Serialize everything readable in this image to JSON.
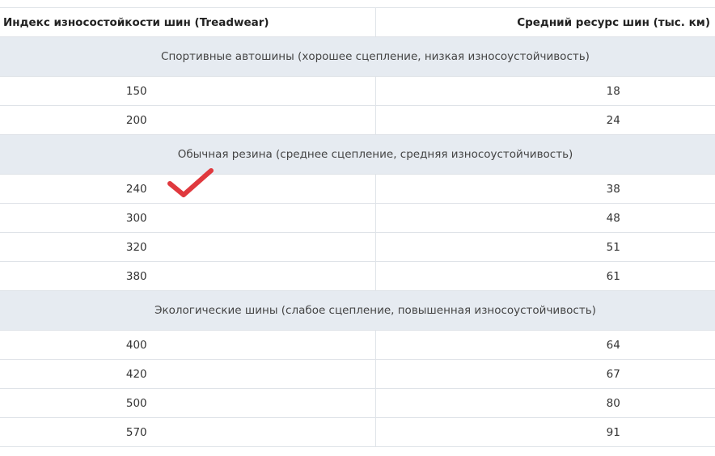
{
  "headers": [
    "Индекс износостойкости шин (Treadwear)",
    "Средний ресурс шин (тыс. км)"
  ],
  "groups": [
    {
      "title": "Спортивные автошины (хорошее сцепление, низкая износоустойчивость)",
      "rows": [
        [
          "150",
          "18"
        ],
        [
          "200",
          "24"
        ]
      ]
    },
    {
      "title": "Обычная резина (среднее сцепление, средняя износоустойчивость)",
      "rows": [
        [
          "240",
          "38"
        ],
        [
          "300",
          "48"
        ],
        [
          "320",
          "51"
        ],
        [
          "380",
          "61"
        ]
      ]
    },
    {
      "title": "Экологические шины (слабое сцепление, повышенная износоустойчивость)",
      "rows": [
        [
          "400",
          "64"
        ],
        [
          "420",
          "67"
        ],
        [
          "500",
          "80"
        ],
        [
          "570",
          "91"
        ]
      ]
    }
  ],
  "colors": {
    "category_bg": "#e6ebf1",
    "checkmark": "#e0393e"
  }
}
